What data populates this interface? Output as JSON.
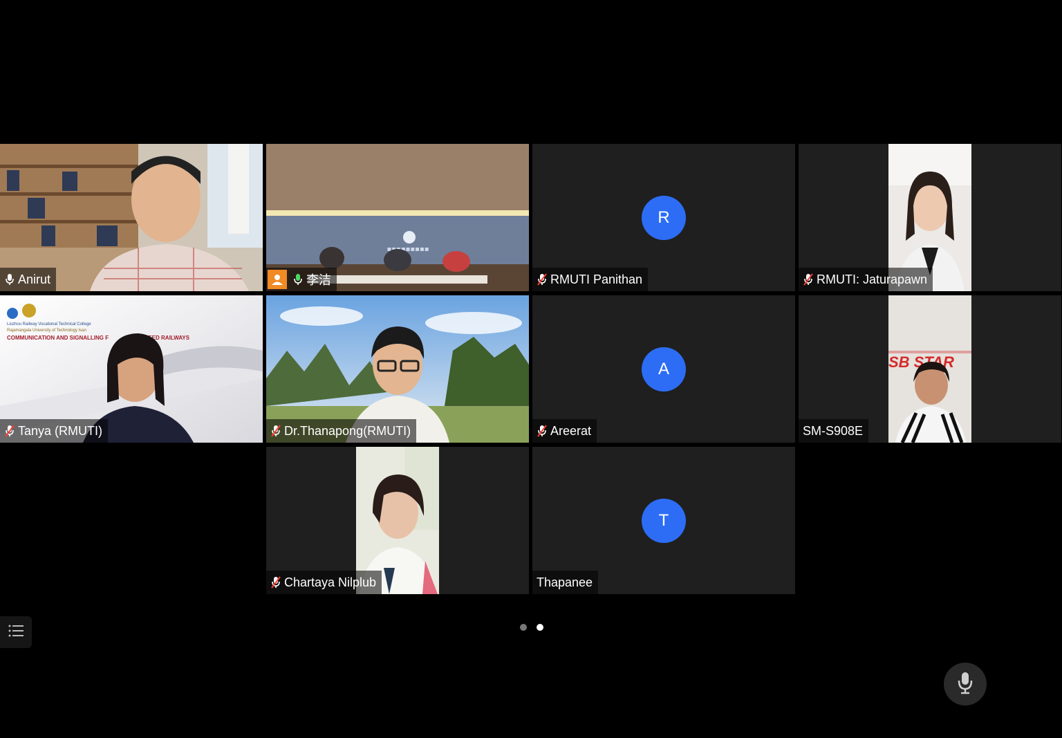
{
  "participants": [
    {
      "name": "Anirut",
      "mic": "on"
    },
    {
      "name": "李洁",
      "mic": "active"
    },
    {
      "name": "RMUTI Panithan",
      "mic": "muted",
      "initial": "R"
    },
    {
      "name": "RMUTI: Jaturapawn",
      "mic": "muted"
    },
    {
      "name": "Tanya (RMUTI)",
      "mic": "muted"
    },
    {
      "name": "Dr.Thanapong(RMUTI)",
      "mic": "muted"
    },
    {
      "name": "Areerat",
      "mic": "muted",
      "initial": "A"
    },
    {
      "name": "SM-S908E",
      "mic": "none"
    },
    {
      "name": "Chartaya Nilplub",
      "mic": "muted"
    },
    {
      "name": "Thapanee",
      "mic": "none",
      "initial": "T"
    }
  ],
  "backgrounds": {
    "slide_college": "Liuzhou Railway Vocational Technical College",
    "slide_university": "Rajamangala University of Technology Isan",
    "slide_title_left": "COMMUNICATION AND SIGNALLING F",
    "slide_title_right": "PEED RAILWAYS",
    "sign_text": "SB STAR"
  },
  "pagination": {
    "pages": 2,
    "current": 2
  },
  "colors": {
    "active_speaker": "#4bd964",
    "avatar": "#2d6df6",
    "muted": "#ff3b30"
  },
  "icons": {
    "list": "list-icon",
    "mic": "microphone-icon"
  }
}
